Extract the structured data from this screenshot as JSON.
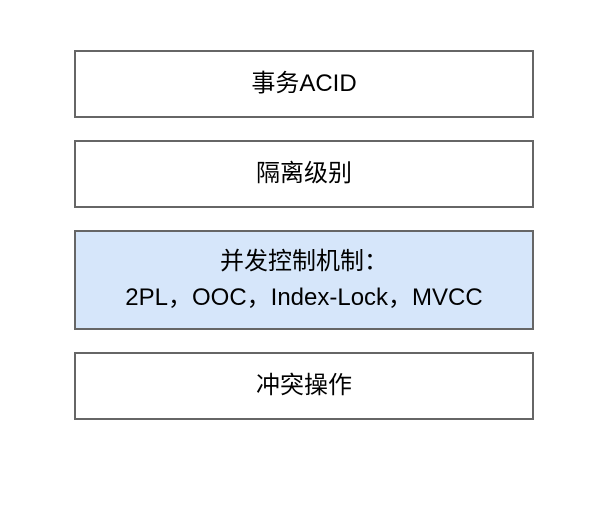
{
  "boxes": [
    {
      "label": "事务ACID",
      "highlight": false,
      "multiline": false
    },
    {
      "label": "隔离级别",
      "highlight": false,
      "multiline": false
    },
    {
      "label": "并发控制机制：\n2PL，OOC，Index-Lock，MVCC",
      "highlight": true,
      "multiline": true
    },
    {
      "label": "冲突操作",
      "highlight": false,
      "multiline": false
    }
  ],
  "colors": {
    "border": "#666666",
    "highlightFill": "#d6e6fa",
    "defaultFill": "#ffffff"
  }
}
